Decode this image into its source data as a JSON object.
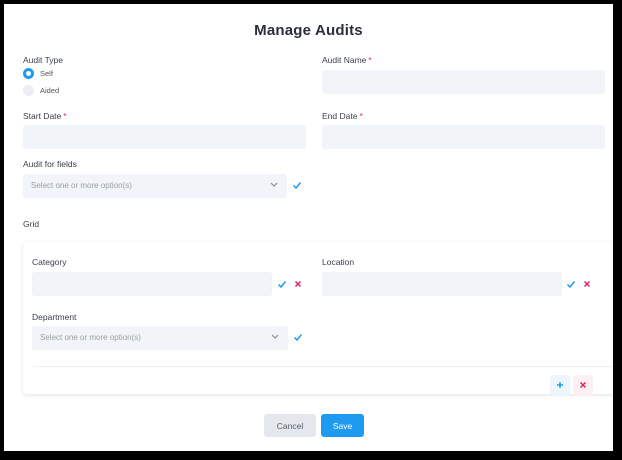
{
  "title": "Manage Audits",
  "audit_type": {
    "label": "Audit Type",
    "options": [
      {
        "label": "Self",
        "selected": true
      },
      {
        "label": "Aided",
        "selected": false
      }
    ]
  },
  "audit_name": {
    "label": "Audit Name",
    "required_mark": "*",
    "value": ""
  },
  "start_date": {
    "label": "Start Date",
    "required_mark": "*",
    "value": ""
  },
  "end_date": {
    "label": "End Date",
    "required_mark": "*",
    "value": ""
  },
  "audit_for_fields": {
    "label": "Audit for fields",
    "placeholder": "Select one or more option(s)"
  },
  "grid": {
    "label": "Grid",
    "category": {
      "label": "Category",
      "value": ""
    },
    "location": {
      "label": "Location",
      "value": ""
    },
    "department": {
      "label": "Department",
      "placeholder": "Select one or more option(s)"
    }
  },
  "buttons": {
    "cancel": "Cancel",
    "save": "Save"
  },
  "colors": {
    "accent": "#1e9bf0",
    "danger": "#e0245e",
    "field_bg": "#f1f4f8"
  },
  "icons": [
    "check-icon",
    "close-icon",
    "plus-icon",
    "chevron-down-icon"
  ]
}
